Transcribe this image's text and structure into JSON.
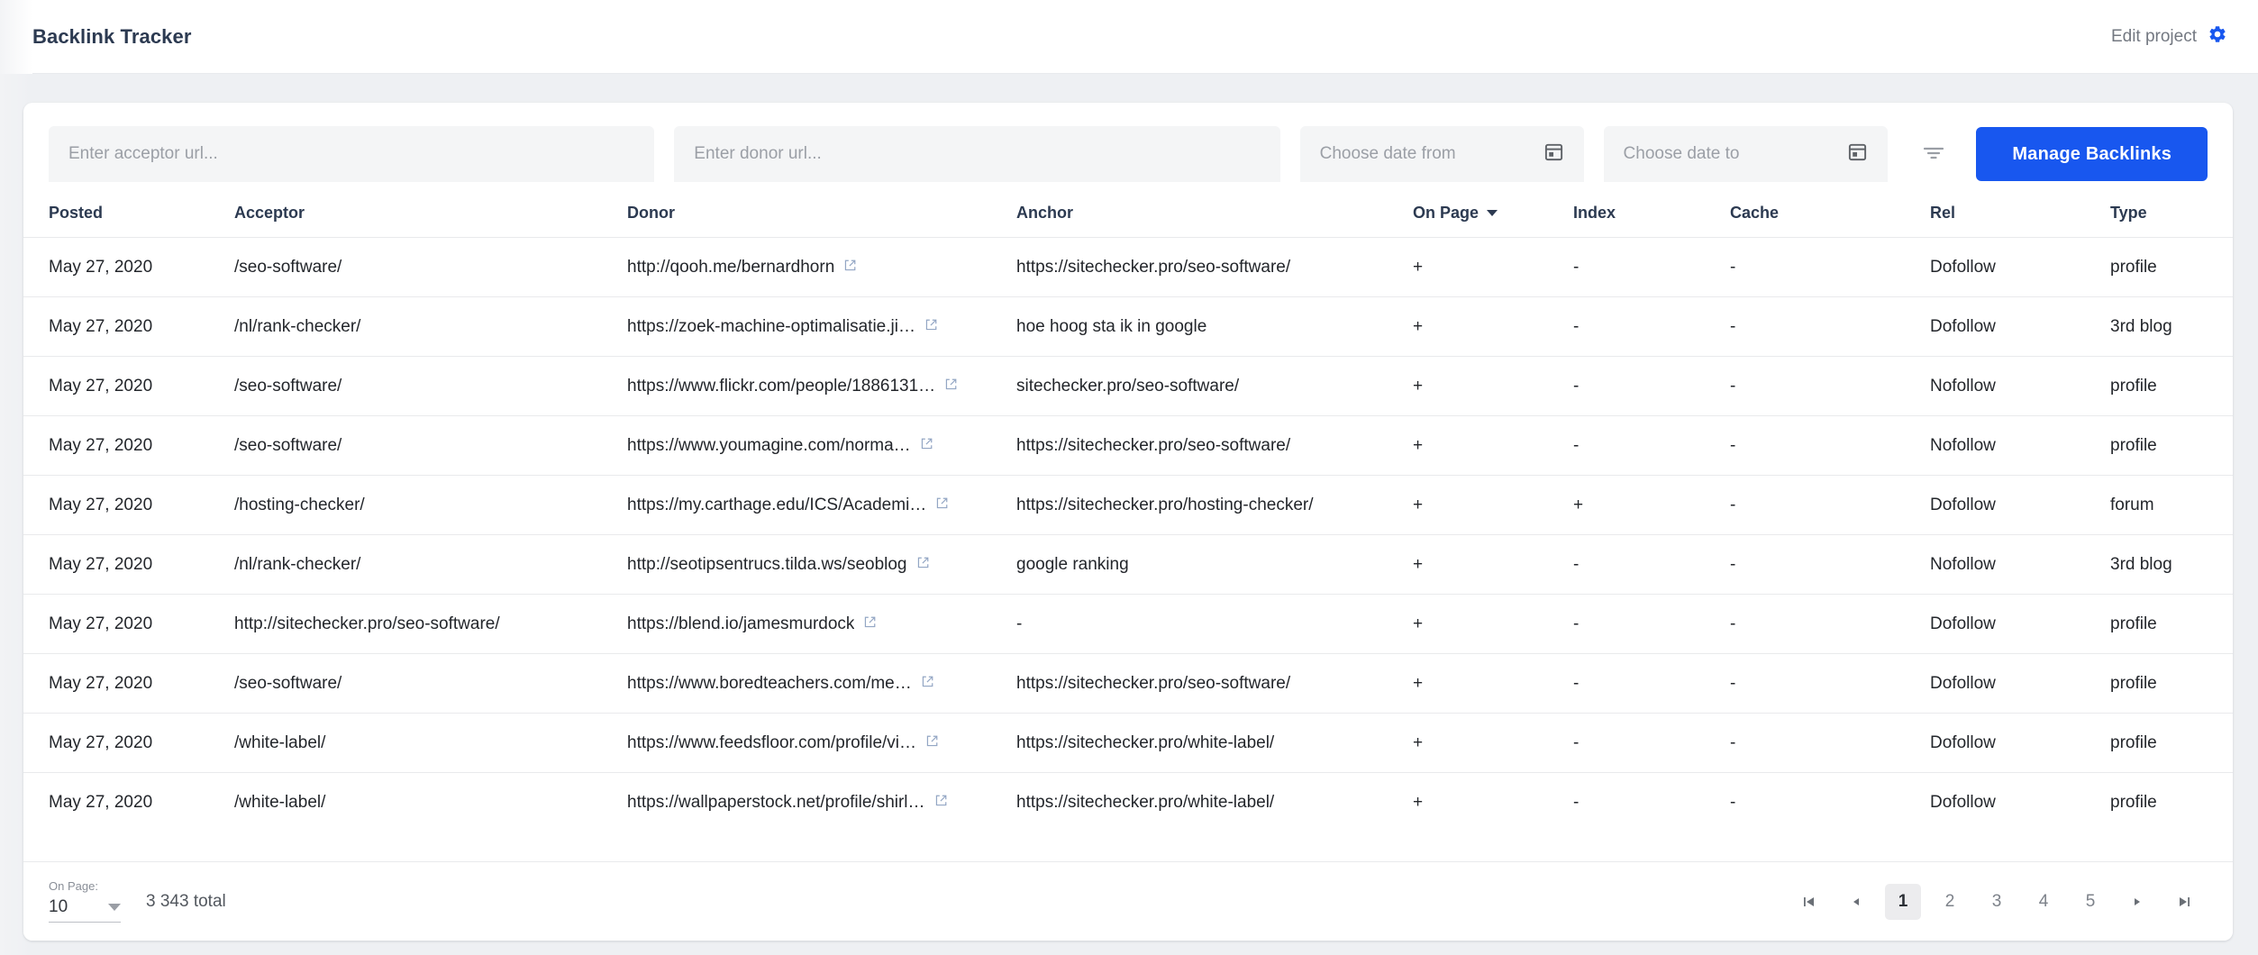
{
  "header": {
    "title": "Backlink Tracker",
    "edit_project_label": "Edit project",
    "gear_icon": "gear-icon",
    "accent_color": "#1857ef"
  },
  "filters": {
    "acceptor_placeholder": "Enter acceptor url...",
    "acceptor_value": "",
    "donor_placeholder": "Enter donor url...",
    "donor_value": "",
    "date_from_placeholder": "Choose date from",
    "date_from_value": "",
    "date_to_placeholder": "Choose date to",
    "date_to_value": "",
    "calendar_icon": "calendar-icon",
    "filter_icon": "filter-icon",
    "manage_button_label": "Manage Backlinks"
  },
  "table": {
    "columns": [
      {
        "key": "posted",
        "label": "Posted",
        "sorted": false
      },
      {
        "key": "acceptor",
        "label": "Acceptor",
        "sorted": false
      },
      {
        "key": "donor",
        "label": "Donor",
        "sorted": false
      },
      {
        "key": "anchor",
        "label": "Anchor",
        "sorted": false
      },
      {
        "key": "on_page",
        "label": "On Page",
        "sorted": true
      },
      {
        "key": "index",
        "label": "Index",
        "sorted": false
      },
      {
        "key": "cache",
        "label": "Cache",
        "sorted": false
      },
      {
        "key": "rel",
        "label": "Rel",
        "sorted": false
      },
      {
        "key": "type",
        "label": "Type",
        "sorted": false
      }
    ],
    "rows": [
      {
        "posted": "May 27, 2020",
        "acceptor": "/seo-software/",
        "donor": "http://qooh.me/bernardhorn",
        "anchor": "https://sitechecker.pro/seo-software/",
        "on_page": "+",
        "index": "-",
        "cache": "-",
        "rel": "Dofollow",
        "type": "profile"
      },
      {
        "posted": "May 27, 2020",
        "acceptor": "/nl/rank-checker/",
        "donor": "https://zoek-machine-optimalisatie.ji…",
        "anchor": "hoe hoog sta ik in google",
        "on_page": "+",
        "index": "-",
        "cache": "-",
        "rel": "Dofollow",
        "type": "3rd blog"
      },
      {
        "posted": "May 27, 2020",
        "acceptor": "/seo-software/",
        "donor": "https://www.flickr.com/people/1886131…",
        "anchor": "sitechecker.pro/seo-software/",
        "on_page": "+",
        "index": "-",
        "cache": "-",
        "rel": "Nofollow",
        "type": "profile"
      },
      {
        "posted": "May 27, 2020",
        "acceptor": "/seo-software/",
        "donor": "https://www.youmagine.com/norma…",
        "anchor": "https://sitechecker.pro/seo-software/",
        "on_page": "+",
        "index": "-",
        "cache": "-",
        "rel": "Nofollow",
        "type": "profile"
      },
      {
        "posted": "May 27, 2020",
        "acceptor": "/hosting-checker/",
        "donor": "https://my.carthage.edu/ICS/Academi…",
        "anchor": "https://sitechecker.pro/hosting-checker/",
        "on_page": "+",
        "index": "+",
        "cache": "-",
        "rel": "Dofollow",
        "type": "forum"
      },
      {
        "posted": "May 27, 2020",
        "acceptor": "/nl/rank-checker/",
        "donor": "http://seotipsentrucs.tilda.ws/seoblog",
        "anchor": "google ranking",
        "on_page": "+",
        "index": "-",
        "cache": "-",
        "rel": "Nofollow",
        "type": "3rd blog"
      },
      {
        "posted": "May 27, 2020",
        "acceptor": "http://sitechecker.pro/seo-software/",
        "donor": "https://blend.io/jamesmurdock",
        "anchor": "-",
        "on_page": "+",
        "index": "-",
        "cache": "-",
        "rel": "Dofollow",
        "type": "profile"
      },
      {
        "posted": "May 27, 2020",
        "acceptor": "/seo-software/",
        "donor": "https://www.boredteachers.com/me…",
        "anchor": "https://sitechecker.pro/seo-software/",
        "on_page": "+",
        "index": "-",
        "cache": "-",
        "rel": "Dofollow",
        "type": "profile"
      },
      {
        "posted": "May 27, 2020",
        "acceptor": "/white-label/",
        "donor": "https://www.feedsfloor.com/profile/vi…",
        "anchor": "https://sitechecker.pro/white-label/",
        "on_page": "+",
        "index": "-",
        "cache": "-",
        "rel": "Dofollow",
        "type": "profile"
      },
      {
        "posted": "May 27, 2020",
        "acceptor": "/white-label/",
        "donor": "https://wallpaperstock.net/profile/shirl…",
        "anchor": "https://sitechecker.pro/white-label/",
        "on_page": "+",
        "index": "-",
        "cache": "-",
        "rel": "Dofollow",
        "type": "profile"
      }
    ]
  },
  "footer": {
    "on_page_label": "On Page:",
    "on_page_value": "10",
    "total_label": "3 343 total",
    "pages": [
      "1",
      "2",
      "3",
      "4",
      "5"
    ],
    "active_page": "1",
    "first_icon": "first-page-icon",
    "prev_icon": "previous-page-icon",
    "next_icon": "next-page-icon",
    "last_icon": "last-page-icon"
  }
}
